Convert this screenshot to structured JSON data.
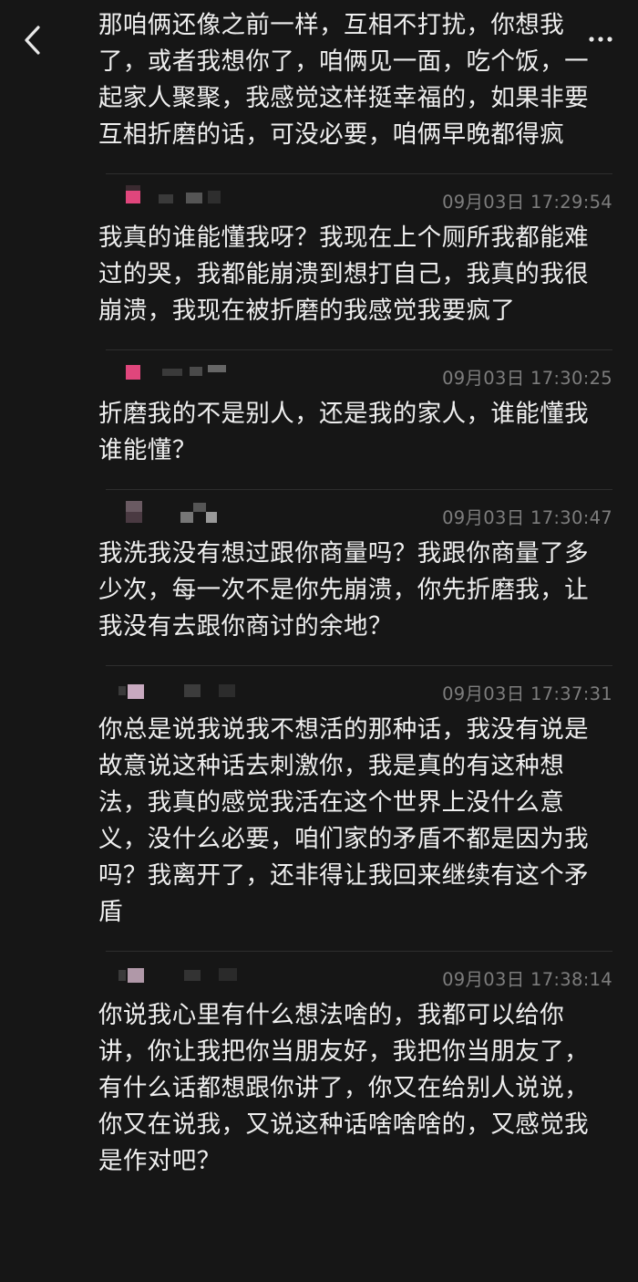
{
  "nav": {
    "back_icon": "chevron-left-icon",
    "more_icon": "more-horizontal-icon"
  },
  "messages": [
    {
      "sender": "",
      "time": "",
      "text": "那咱俩还像之前一样，互相不打扰，你想我了，或者我想你了，咱俩见一面，吃个饭，一起家人聚聚，我感觉这样挺幸福的，如果非要互相折磨的话，可没必要，咱俩早晚都得疯"
    },
    {
      "sender": "",
      "time": "09月03日 17:29:54",
      "text": "我真的谁能懂我呀？我现在上个厕所我都能难过的哭，我都能崩溃到想打自己，我真的我很崩溃，我现在被折磨的我感觉我要疯了"
    },
    {
      "sender": "",
      "time": "09月03日 17:30:25",
      "text": "折磨我的不是别人，还是我的家人，谁能懂我谁能懂？"
    },
    {
      "sender": "",
      "time": "09月03日 17:30:47",
      "text": "我洗我没有想过跟你商量吗？我跟你商量了多少次，每一次不是你先崩溃，你先折磨我，让我没有去跟你商讨的余地？"
    },
    {
      "sender": "",
      "time": "09月03日 17:37:31",
      "text": "你总是说我说我不想活的那种话，我没有说是故意说这种话去刺激你，我是真的有这种想法，我真的感觉我活在这个世界上没什么意义，没什么必要，咱们家的矛盾不都是因为我吗？我离开了，还非得让我回来继续有这个矛盾"
    },
    {
      "sender": "",
      "time": "09月03日 17:38:14",
      "text": "你说我心里有什么想法啥的，我都可以给你讲，你让我把你当朋友好，我把你当朋友了，有什么话都想跟你讲了，你又在给别人说说，你又在说我，又说这种话啥啥啥的，又感觉我是作对吧？"
    }
  ],
  "colors": {
    "background": "#161616",
    "text": "#efefef",
    "timestamp": "#7d7d7d",
    "divider": "#2e2e2e",
    "avatar_pink": "#e0467c"
  }
}
